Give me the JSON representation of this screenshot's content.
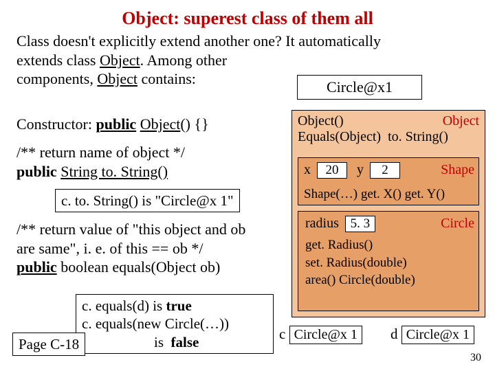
{
  "title": "Object: superest class of them all",
  "intro_1": "Class doesn't explicitly extend another one? It automatically",
  "intro_2a": "extends class ",
  "intro_2b": "Object",
  "intro_2c": ". Among other",
  "intro_3a": "components, ",
  "intro_3b": "Object",
  "intro_3c": " contains:",
  "circle_at": "Circle@x1",
  "constructor_a": "Constructor:  ",
  "constructor_b": "public",
  "constructor_c": " ",
  "constructor_d": "Object",
  "constructor_e": "() {}",
  "retname_1": "/** return name of object */",
  "retname_2a": "public ",
  "retname_2b": "String to. String()",
  "c_tostring": "c. to. String()  is  \"Circle@x 1\"",
  "eq_1": "/** return value of \"this object and ob",
  "eq_2": "      are same\", i. e. of  this == ob */",
  "eq_3a": "public",
  "eq_3b": " boolean equals(Object ob)",
  "equals_box_1a": "c. equals(d)  is  ",
  "equals_box_1b": "true",
  "equals_box_2": "c. equals(new Circle(…))",
  "equals_box_3a": "                    is  ",
  "equals_box_3b": "false",
  "page": "Page C-18",
  "obj": {
    "m1": "Object()",
    "m2": "Equals(Object)",
    "m3": "to. String()",
    "label": "Object"
  },
  "shape": {
    "x_lbl": "x",
    "x_val": "20",
    "y_lbl": "y",
    "y_val": "2",
    "label": "Shape",
    "methods": "Shape(…)  get. X()  get. Y()"
  },
  "circle": {
    "rlbl": "radius",
    "rval": "5. 3",
    "label": "Circle",
    "m1": "get. Radius()",
    "m2": "set. Radius(double)",
    "m3": "area()  Circle(double)"
  },
  "var_c": {
    "name": "c",
    "val": "Circle@x 1"
  },
  "var_d": {
    "name": "d",
    "val": "Circle@x 1"
  },
  "slidenum": "30"
}
